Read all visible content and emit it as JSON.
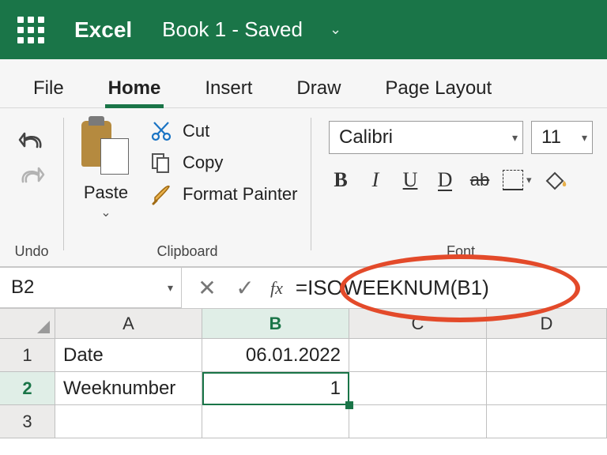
{
  "header": {
    "app_name": "Excel",
    "doc_title": "Book 1 - Saved"
  },
  "tabs": {
    "file": "File",
    "home": "Home",
    "insert": "Insert",
    "draw": "Draw",
    "page_layout": "Page Layout"
  },
  "ribbon": {
    "undo_group": "Undo",
    "clipboard": {
      "paste": "Paste",
      "cut": "Cut",
      "copy": "Copy",
      "format_painter": "Format Painter",
      "group": "Clipboard"
    },
    "font": {
      "name": "Calibri",
      "size": "11",
      "bold": "B",
      "italic": "I",
      "underline": "U",
      "double_underline": "D",
      "strike": "ab",
      "group": "Font"
    }
  },
  "formula_bar": {
    "cell_ref": "B2",
    "fx_label": "fx",
    "formula": "=ISOWEEKNUM(B1)"
  },
  "grid": {
    "columns": {
      "A": "A",
      "B": "B",
      "C": "C",
      "D": "D"
    },
    "rows": {
      "r1": "1",
      "r2": "2",
      "r3": "3"
    },
    "cells": {
      "A1": "Date",
      "B1": "06.01.2022",
      "A2": "Weeknumber",
      "B2": "1"
    }
  }
}
